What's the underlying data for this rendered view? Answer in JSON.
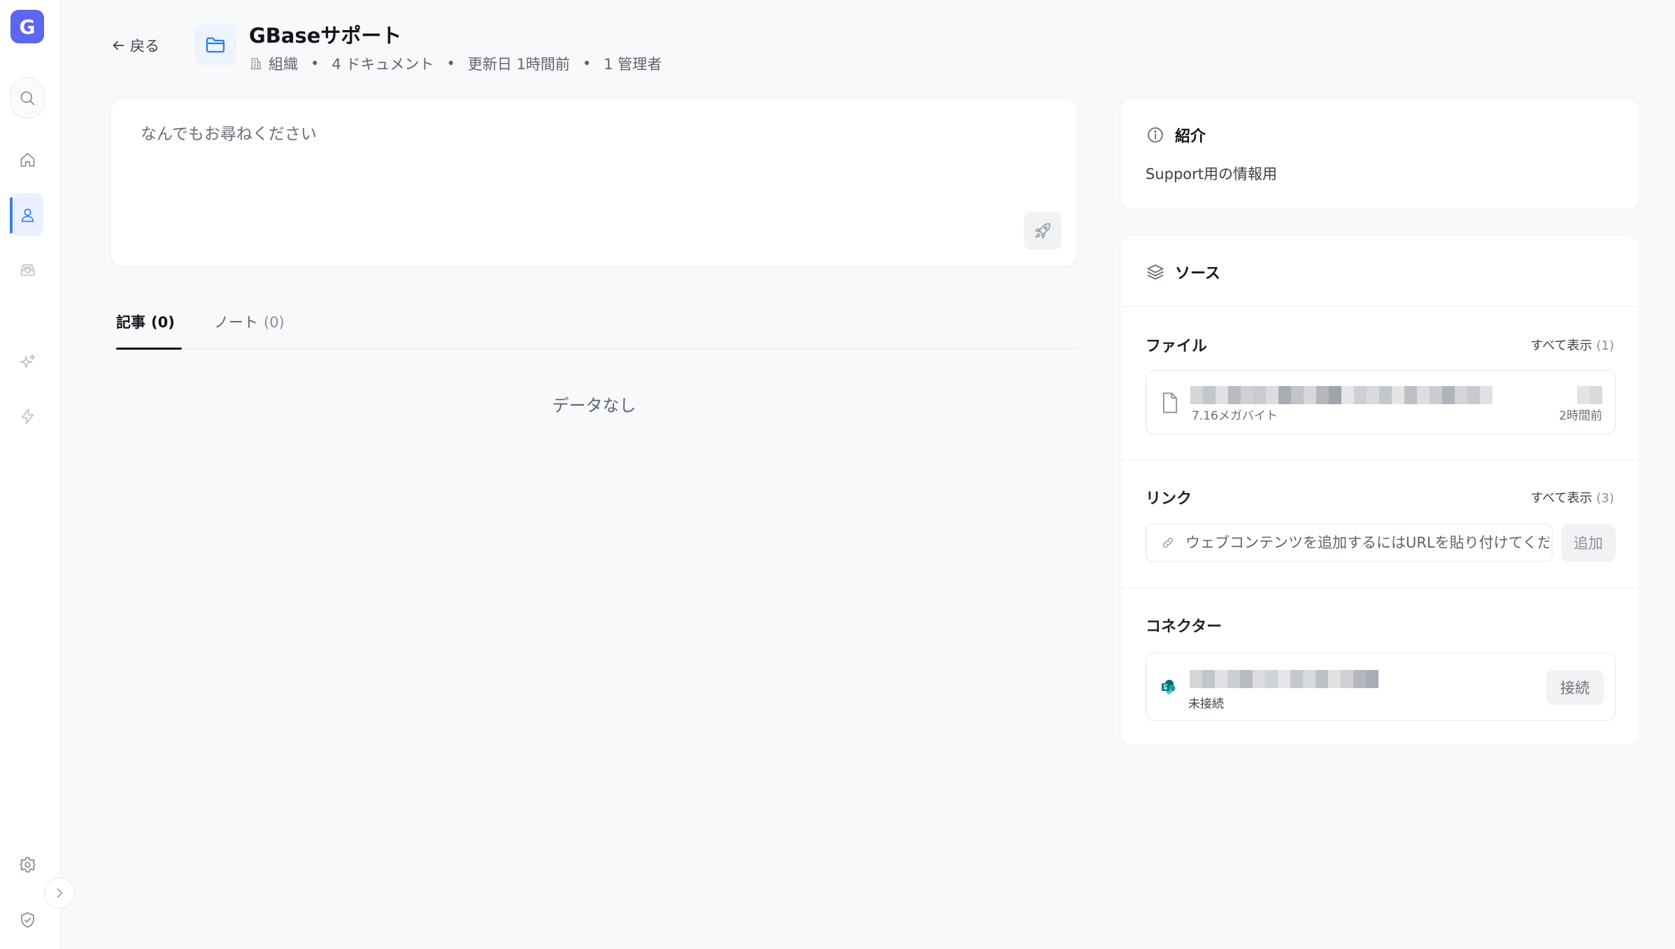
{
  "app": {
    "logo_letter": "G",
    "accent_color": "#5b67f1",
    "active_color": "#3d7ef5"
  },
  "sidebar": {
    "items": [
      {
        "name": "search",
        "icon": "search-icon"
      },
      {
        "name": "home",
        "icon": "home-icon"
      },
      {
        "name": "knowledge",
        "icon": "user-icon",
        "active": true
      },
      {
        "name": "inbox",
        "icon": "inbox-icon"
      },
      {
        "name": "ai",
        "icon": "sparkles-icon"
      },
      {
        "name": "automation",
        "icon": "lightning-icon"
      },
      {
        "name": "settings",
        "icon": "gear-icon"
      },
      {
        "name": "security",
        "icon": "shield-check-icon"
      }
    ],
    "collapse_icon": "chevron-right-icon"
  },
  "header": {
    "back_label": "戻る",
    "title": "GBaseサポート",
    "meta": {
      "scope": "組織",
      "documents": "4 ドキュメント",
      "updated": "更新日 1時間前",
      "admins": "1 管理者"
    }
  },
  "ask": {
    "placeholder": "なんでもお尋ねください"
  },
  "tabs": [
    {
      "label": "記事",
      "count": "(0)",
      "active": true
    },
    {
      "label": "ノート",
      "count": "(0)",
      "active": false
    }
  ],
  "empty_state": "データなし",
  "intro": {
    "title": "紹介",
    "text": "Support用の情報用"
  },
  "sources": {
    "title": "ソース",
    "files": {
      "label": "ファイル",
      "view_all": "すべて表示",
      "count": "(1)",
      "items": [
        {
          "size": "7.16メガバイト",
          "time": "2時間前"
        }
      ]
    },
    "links": {
      "label": "リンク",
      "view_all": "すべて表示",
      "count": "(3)",
      "placeholder": "ウェブコンテンツを追加するにはURLを貼り付けてください",
      "add_label": "追加"
    },
    "connectors": {
      "label": "コネクター",
      "items": [
        {
          "status": "未接続",
          "connect_label": "接続"
        }
      ]
    }
  }
}
